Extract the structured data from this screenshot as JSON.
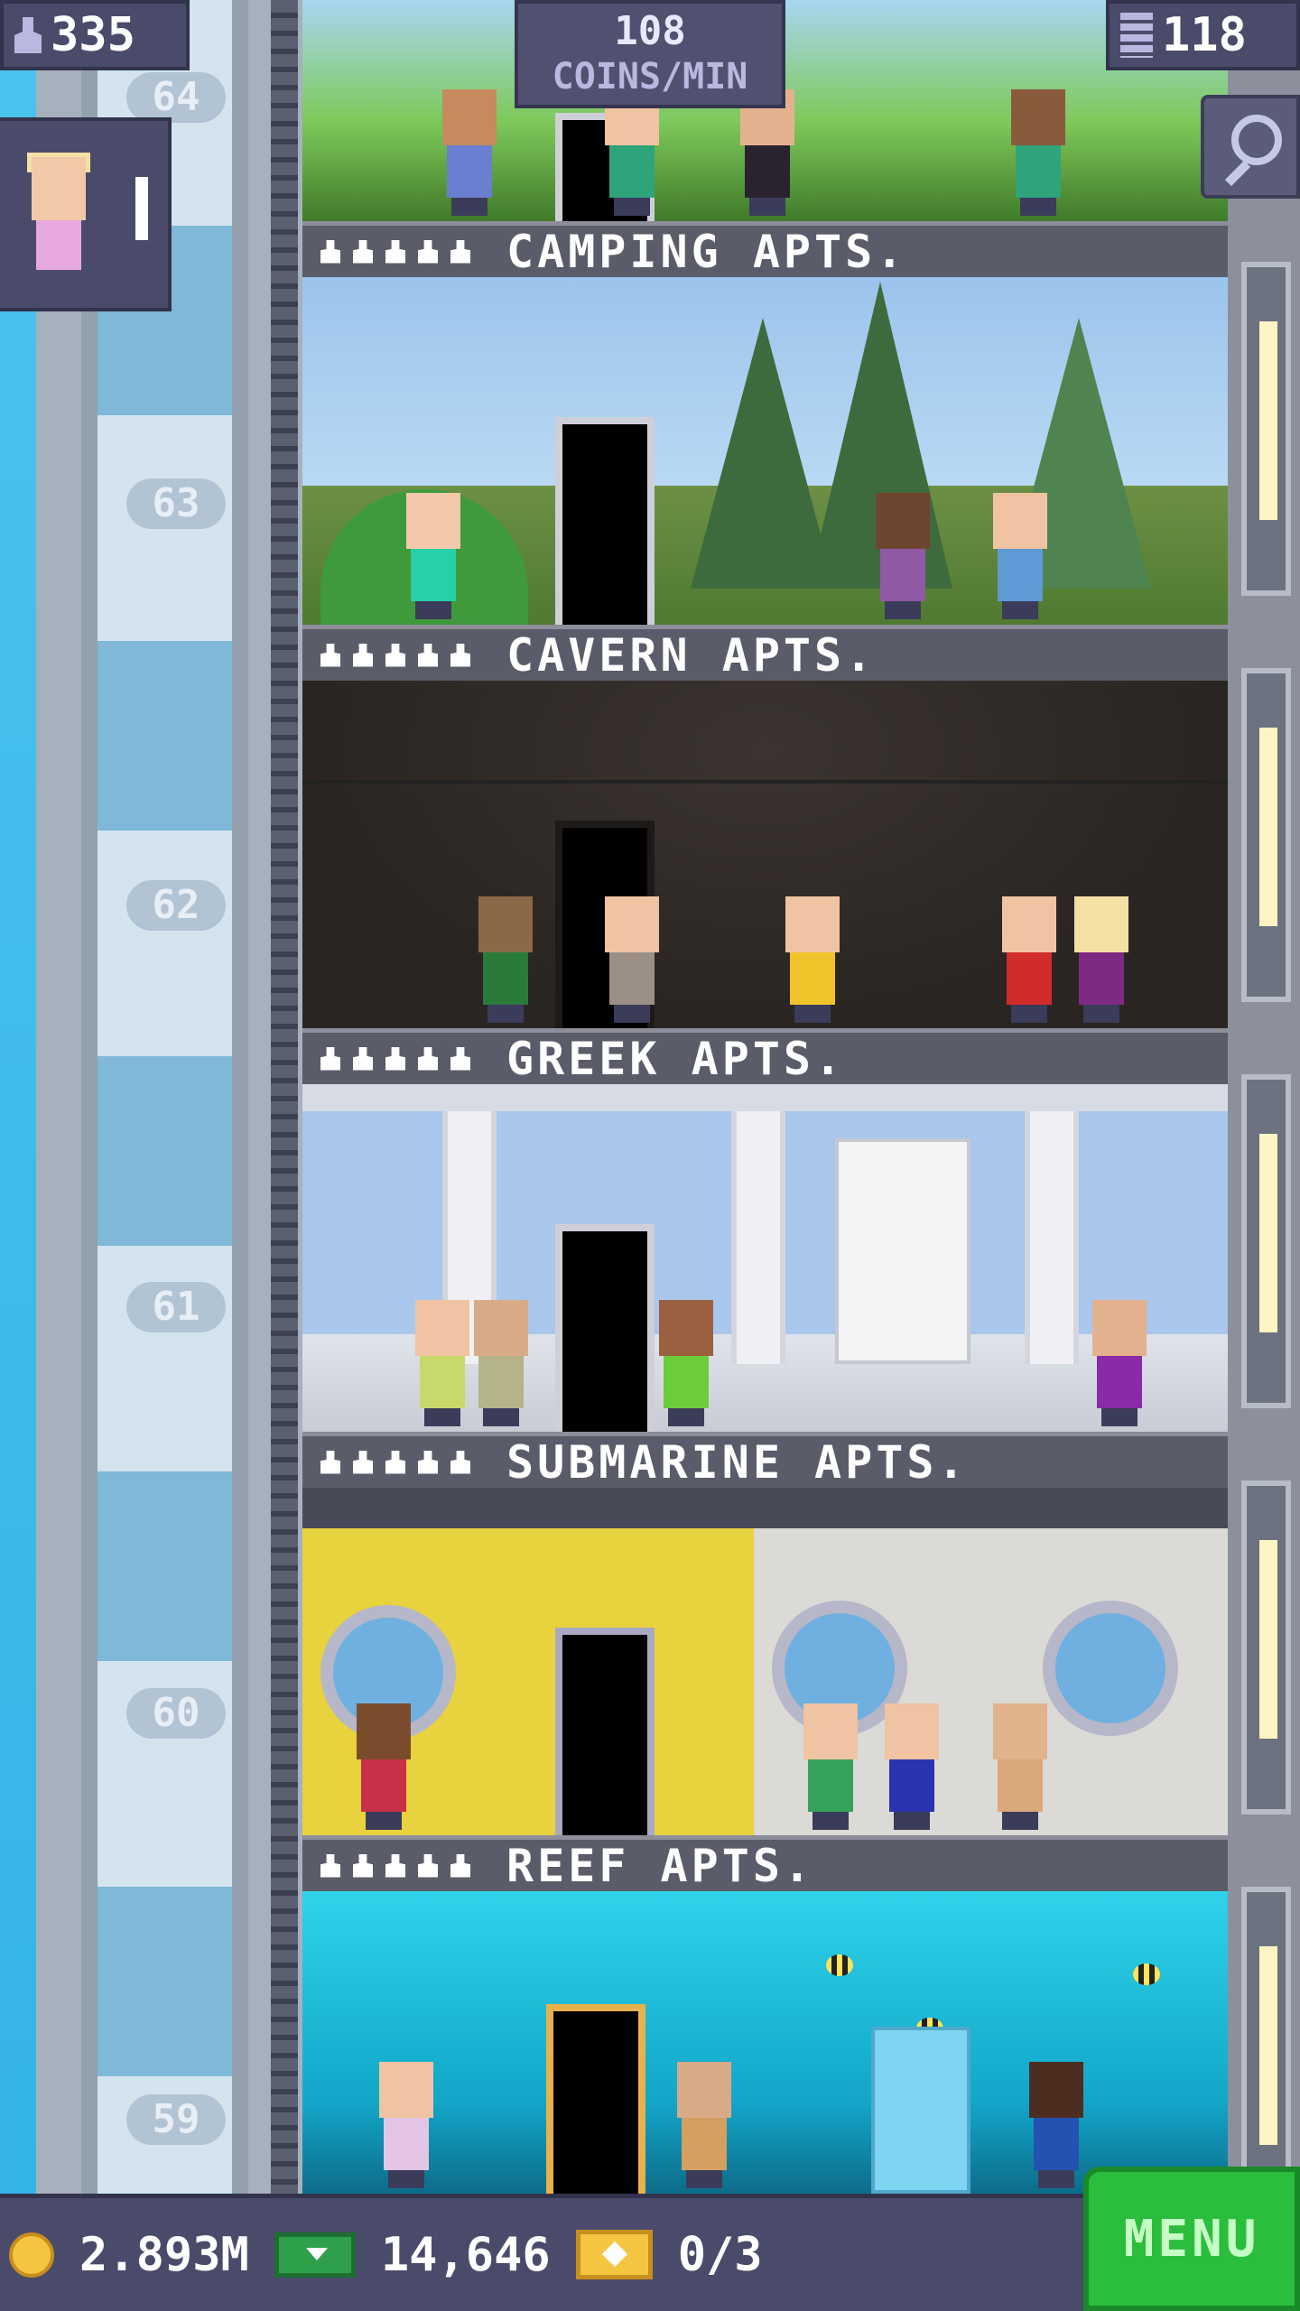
{
  "hud": {
    "population": "335",
    "population_icon": "person-icon",
    "coins_per_min_value": "108",
    "coins_per_min_unit": "COINS/MIN",
    "floors": "118",
    "floors_icon": "building-icon",
    "search_icon": "magnifier-icon",
    "visitor_icon": "visitor-icon"
  },
  "elevator": {
    "floor_numbers": [
      "64",
      "63",
      "62",
      "61",
      "60",
      "59"
    ]
  },
  "floors": [
    {
      "name": "CAMPING APTS.",
      "stars": 5
    },
    {
      "name": "CAVERN APTS.",
      "stars": 5
    },
    {
      "name": "GREEK APTS.",
      "stars": 5
    },
    {
      "name": "SUBMARINE APTS.",
      "stars": 5
    },
    {
      "name": "REEF APTS.",
      "stars": 5
    }
  ],
  "bottom_bar": {
    "coins": "2.893M",
    "bux": "14,646",
    "tickets": "0/3",
    "menu_label": "MENU"
  },
  "colors": {
    "menu_green": "#2bbd3c",
    "hud_purple": "#4a4a6a",
    "sky_blue": "#4cc3ef"
  }
}
